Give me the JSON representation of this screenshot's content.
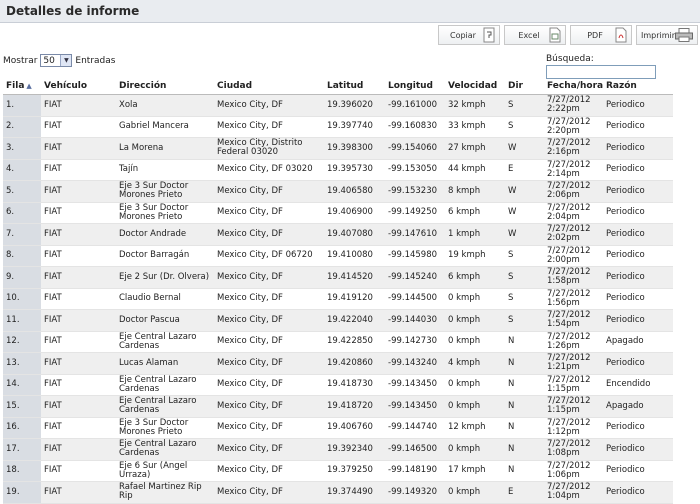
{
  "header": {
    "title": "Detalles de informe"
  },
  "toolbar": {
    "copy": "Copiar",
    "excel": "Excel",
    "pdf": "PDF",
    "print": "Imprimir"
  },
  "length": {
    "prefix": "Mostrar",
    "value": "50",
    "suffix": "Entradas"
  },
  "search": {
    "label": "Búsqueda:",
    "value": ""
  },
  "columns": [
    "Fila",
    "Vehículo",
    "Dirección",
    "Ciudad",
    "Latitud",
    "Longitud",
    "Velocidad",
    "Dir",
    "Fecha/hora",
    "Razón"
  ],
  "rows": [
    {
      "fila": "1.",
      "veh": "FIAT",
      "dir": "Xola",
      "ciudad": "Mexico City, DF",
      "lat": "19.396020",
      "lon": "-99.161000",
      "vel": "32 kmph",
      "d": "S",
      "fecha": "7/27/2012 2:22pm",
      "razon": "Periodico"
    },
    {
      "fila": "2.",
      "veh": "FIAT",
      "dir": "Gabriel Mancera",
      "ciudad": "Mexico City, DF",
      "lat": "19.397740",
      "lon": "-99.160830",
      "vel": "33 kmph",
      "d": "S",
      "fecha": "7/27/2012 2:20pm",
      "razon": "Periodico"
    },
    {
      "fila": "3.",
      "veh": "FIAT",
      "dir": "La Morena",
      "ciudad": "Mexico City, Distrito Federal 03020",
      "lat": "19.398300",
      "lon": "-99.154060",
      "vel": "27 kmph",
      "d": "W",
      "fecha": "7/27/2012 2:16pm",
      "razon": "Periodico"
    },
    {
      "fila": "4.",
      "veh": "FIAT",
      "dir": "Tajín",
      "ciudad": "Mexico City, DF 03020",
      "lat": "19.395730",
      "lon": "-99.153050",
      "vel": "44 kmph",
      "d": "E",
      "fecha": "7/27/2012 2:14pm",
      "razon": "Periodico"
    },
    {
      "fila": "5.",
      "veh": "FIAT",
      "dir": "Eje 3 Sur Doctor Morones Prieto",
      "ciudad": "Mexico City, DF",
      "lat": "19.406580",
      "lon": "-99.153230",
      "vel": "8 kmph",
      "d": "W",
      "fecha": "7/27/2012 2:06pm",
      "razon": "Periodico"
    },
    {
      "fila": "6.",
      "veh": "FIAT",
      "dir": "Eje 3 Sur Doctor Morones Prieto",
      "ciudad": "Mexico City, DF",
      "lat": "19.406900",
      "lon": "-99.149250",
      "vel": "6 kmph",
      "d": "W",
      "fecha": "7/27/2012 2:04pm",
      "razon": "Periodico"
    },
    {
      "fila": "7.",
      "veh": "FIAT",
      "dir": "Doctor Andrade",
      "ciudad": "Mexico City, DF",
      "lat": "19.407080",
      "lon": "-99.147610",
      "vel": "1 kmph",
      "d": "W",
      "fecha": "7/27/2012 2:02pm",
      "razon": "Periodico"
    },
    {
      "fila": "8.",
      "veh": "FIAT",
      "dir": "Doctor Barragán",
      "ciudad": "Mexico City, DF 06720",
      "lat": "19.410080",
      "lon": "-99.145980",
      "vel": "19 kmph",
      "d": "S",
      "fecha": "7/27/2012 2:00pm",
      "razon": "Periodico"
    },
    {
      "fila": "9.",
      "veh": "FIAT",
      "dir": "Eje 2 Sur (Dr. Olvera)",
      "ciudad": "Mexico City, DF",
      "lat": "19.414520",
      "lon": "-99.145240",
      "vel": "6 kmph",
      "d": "S",
      "fecha": "7/27/2012 1:58pm",
      "razon": "Periodico"
    },
    {
      "fila": "10.",
      "veh": "FIAT",
      "dir": "Claudio Bernal",
      "ciudad": "Mexico City, DF",
      "lat": "19.419120",
      "lon": "-99.144500",
      "vel": "0 kmph",
      "d": "S",
      "fecha": "7/27/2012 1:56pm",
      "razon": "Periodico"
    },
    {
      "fila": "11.",
      "veh": "FIAT",
      "dir": "Doctor Pascua",
      "ciudad": "Mexico City, DF",
      "lat": "19.422040",
      "lon": "-99.144030",
      "vel": "0 kmph",
      "d": "S",
      "fecha": "7/27/2012 1:54pm",
      "razon": "Periodico"
    },
    {
      "fila": "12.",
      "veh": "FIAT",
      "dir": "Eje Central Lazaro Cardenas",
      "ciudad": "Mexico City, DF",
      "lat": "19.422850",
      "lon": "-99.142730",
      "vel": "0 kmph",
      "d": "N",
      "fecha": "7/27/2012 1:26pm",
      "razon": "Apagado"
    },
    {
      "fila": "13.",
      "veh": "FIAT",
      "dir": "Lucas Alaman",
      "ciudad": "Mexico City, DF",
      "lat": "19.420860",
      "lon": "-99.143240",
      "vel": "4 kmph",
      "d": "N",
      "fecha": "7/27/2012 1:21pm",
      "razon": "Periodico"
    },
    {
      "fila": "14.",
      "veh": "FIAT",
      "dir": "Eje Central Lazaro Cardenas",
      "ciudad": "Mexico City, DF",
      "lat": "19.418730",
      "lon": "-99.143450",
      "vel": "0 kmph",
      "d": "N",
      "fecha": "7/27/2012 1:15pm",
      "razon": "Encendido"
    },
    {
      "fila": "15.",
      "veh": "FIAT",
      "dir": "Eje Central Lazaro Cardenas",
      "ciudad": "Mexico City, DF",
      "lat": "19.418720",
      "lon": "-99.143450",
      "vel": "0 kmph",
      "d": "N",
      "fecha": "7/27/2012 1:15pm",
      "razon": "Apagado"
    },
    {
      "fila": "16.",
      "veh": "FIAT",
      "dir": "Eje 3 Sur Doctor Morones Prieto",
      "ciudad": "Mexico City, DF",
      "lat": "19.406760",
      "lon": "-99.144740",
      "vel": "12 kmph",
      "d": "N",
      "fecha": "7/27/2012 1:12pm",
      "razon": "Periodico"
    },
    {
      "fila": "17.",
      "veh": "FIAT",
      "dir": "Eje Central Lazaro Cardenas",
      "ciudad": "Mexico City, DF",
      "lat": "19.392340",
      "lon": "-99.146500",
      "vel": "0 kmph",
      "d": "N",
      "fecha": "7/27/2012 1:08pm",
      "razon": "Periodico"
    },
    {
      "fila": "18.",
      "veh": "FIAT",
      "dir": "Eje 6 Sur (Angel Urraza)",
      "ciudad": "Mexico City, DF",
      "lat": "19.379250",
      "lon": "-99.148190",
      "vel": "17 kmph",
      "d": "N",
      "fecha": "7/27/2012 1:06pm",
      "razon": "Periodico"
    },
    {
      "fila": "19.",
      "veh": "FIAT",
      "dir": "Rafael Martinez Rip Rip",
      "ciudad": "Mexico City, DF",
      "lat": "19.374490",
      "lon": "-99.149320",
      "vel": "0 kmph",
      "d": "E",
      "fecha": "7/27/2012 1:04pm",
      "razon": "Periodico"
    }
  ]
}
